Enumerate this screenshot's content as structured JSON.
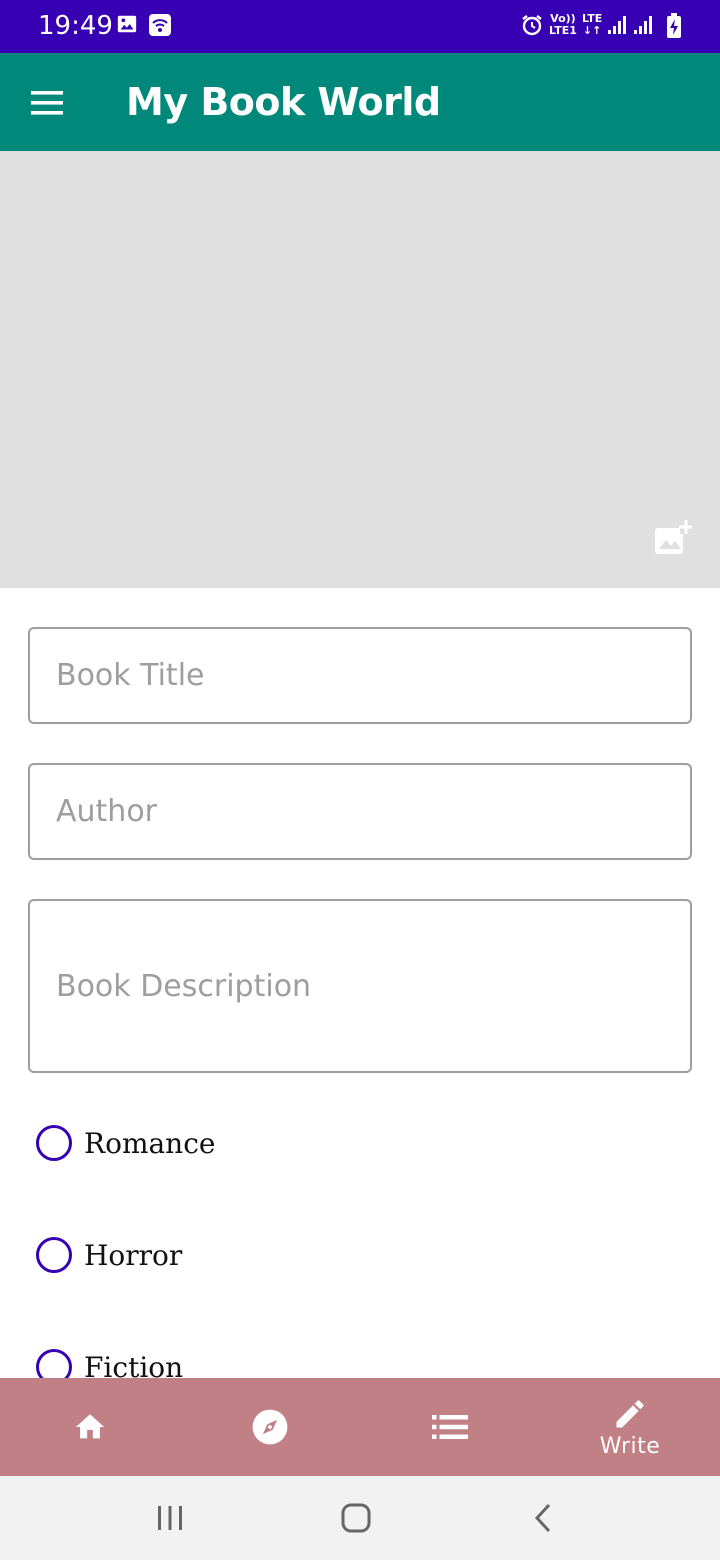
{
  "status_bar": {
    "time": "19:49",
    "volte": "Vo))",
    "lte1": "LTE1",
    "lte": "LTE",
    "icons": [
      "image-icon",
      "wifi-icon",
      "alarm-icon",
      "signal-icon",
      "signal-icon",
      "battery-icon"
    ],
    "background": "#3700b3"
  },
  "app_bar": {
    "title": "My Book World",
    "background": "#00897b"
  },
  "cover": {
    "background": "#e0e0e0",
    "icon": "add-photo-icon"
  },
  "form": {
    "title_placeholder": "Book Title",
    "title_value": "",
    "author_placeholder": "Author",
    "author_value": "",
    "description_placeholder": "Book Description",
    "description_value": ""
  },
  "genres": [
    {
      "label": "Romance",
      "selected": false
    },
    {
      "label": "Horror",
      "selected": false
    },
    {
      "label": "Fiction",
      "selected": false
    }
  ],
  "bottom_nav": {
    "background": "#c17f86",
    "items": [
      {
        "icon": "home-icon",
        "label": ""
      },
      {
        "icon": "explore-icon",
        "label": ""
      },
      {
        "icon": "list-icon",
        "label": ""
      },
      {
        "icon": "edit-icon",
        "label": "Write"
      }
    ]
  },
  "system_nav": {
    "icons": [
      "recent-apps-icon",
      "home-button-icon",
      "back-icon"
    ]
  }
}
